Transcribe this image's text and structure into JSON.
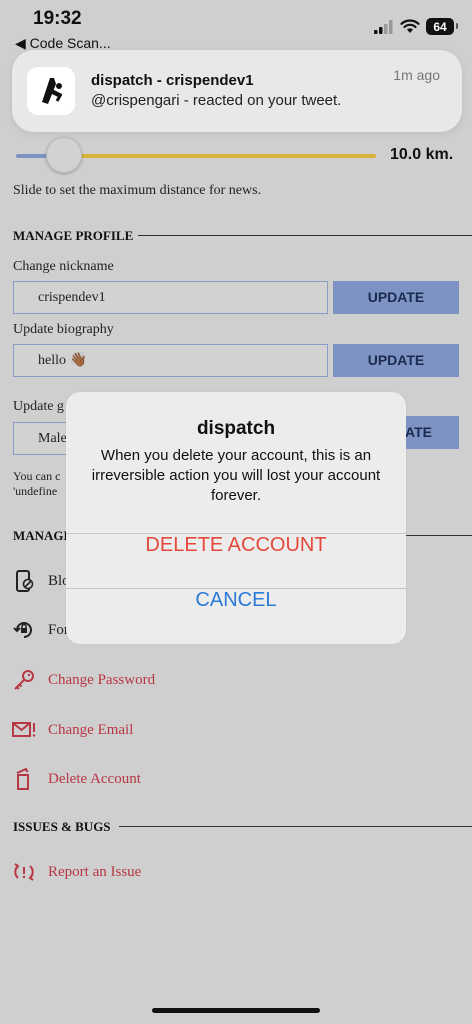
{
  "status_bar": {
    "time": "19:32",
    "back_app": "◀ Code Scan...",
    "battery": "64"
  },
  "notification": {
    "title": "dispatch - crispendev1",
    "body": "@crispengari - reacted on your tweet.",
    "time": "1m ago"
  },
  "distance": {
    "value_label": "10.0 km.",
    "fraction": 0.13,
    "hint": "Slide to set the maximum distance for news."
  },
  "manage_profile": {
    "title": "MANAGE PROFILE",
    "nickname_label": "Change nickname",
    "nickname_value": "crispendev1",
    "bio_label": "Update biography",
    "bio_value": "hello 👋🏾",
    "gender_label": "Update g",
    "gender_value": "Male",
    "update_label": "UPDATE",
    "update_label_partial": "ATE",
    "note_line1": "You can c",
    "note_line2": "'undefine"
  },
  "manage_account": {
    "title": "MANAGE",
    "items": [
      {
        "label": "Blo",
        "icon": "phone-block-icon"
      },
      {
        "label": "For",
        "icon": "lock-reset-icon"
      },
      {
        "label": "Change Password",
        "icon": "key-icon"
      },
      {
        "label": "Change Email",
        "icon": "mail-alert-icon"
      },
      {
        "label": "Delete Account",
        "icon": "delete-icon"
      }
    ]
  },
  "issues": {
    "title": "ISSUES & BUGS",
    "items": [
      {
        "label": "Report an Issue",
        "icon": "report-issue-icon"
      }
    ]
  },
  "alert": {
    "title": "dispatch",
    "message": "When you delete your account, this is an irreversible action you will lost your account forever.",
    "delete_label": "DELETE ACCOUNT",
    "cancel_label": "CANCEL"
  },
  "colors": {
    "accent_blue": "#7d93c4",
    "slider_yellow": "#d9b23b",
    "danger_red": "#b83744",
    "alert_delete": "#e5483a",
    "alert_cancel": "#2a7ad7"
  }
}
